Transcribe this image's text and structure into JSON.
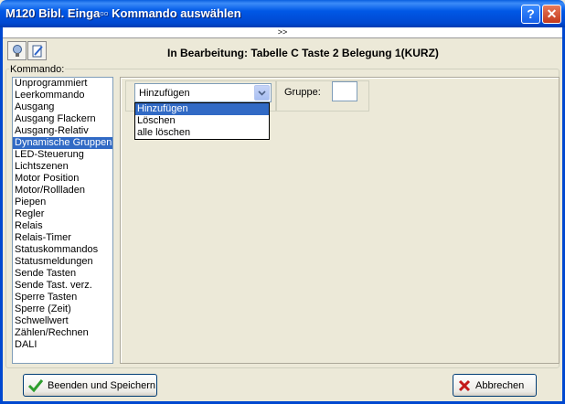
{
  "window": {
    "title": "M120 Bibl. Einga▫▫ Kommando auswählen",
    "help_glyph": "?",
    "close_glyph": "✕"
  },
  "expander": {
    "label": ">>"
  },
  "toolbar": {
    "heading": "In Bearbeitung: Tabelle C Taste 2 Belegung 1(KURZ)",
    "icons": [
      "lightbulb-icon",
      "edit-document-icon"
    ]
  },
  "kommando": {
    "group_label": "Kommando:",
    "items": [
      "Unprogrammiert",
      "Leerkommando",
      "Ausgang",
      "Ausgang Flackern",
      "Ausgang-Relativ",
      "Dynamische Gruppen",
      "LED-Steuerung",
      "Lichtszenen",
      "Motor Position",
      "Motor/Rollladen",
      "Piepen",
      "Regler",
      "Relais",
      "Relais-Timer",
      "Statuskommandos",
      "Statusmeldungen",
      "Sende Tasten",
      "Sende Tast. verz.",
      "Sperre Tasten",
      "Sperre (Zeit)",
      "Schwellwert",
      "Zählen/Rechnen",
      "DALI"
    ],
    "selected": "Dynamische Gruppen"
  },
  "action": {
    "value": "Hinzufügen",
    "options": [
      "Hinzufügen",
      "Löschen",
      "alle löschen"
    ],
    "highlighted": "Hinzufügen"
  },
  "gruppe": {
    "label": "Gruppe:",
    "value": ""
  },
  "buttons": {
    "save": {
      "label": "Beenden und Speichern",
      "icon": "checkmark-icon"
    },
    "cancel": {
      "label": "Abbrechen",
      "icon": "red-x-icon"
    }
  },
  "colors": {
    "selection": "#316AC5",
    "title_bar": "#0058E6",
    "check": "#2E9E2E",
    "cancel_x": "#C41A1A"
  }
}
